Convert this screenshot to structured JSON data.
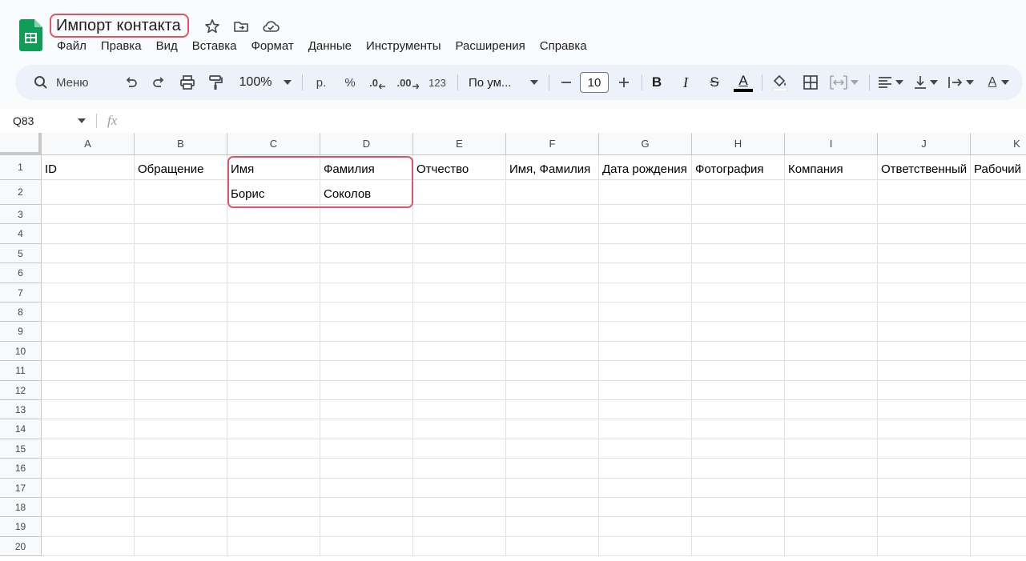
{
  "document": {
    "title": "Импорт контакта"
  },
  "menu": [
    "Файл",
    "Правка",
    "Вид",
    "Вставка",
    "Формат",
    "Данные",
    "Инструменты",
    "Расширения",
    "Справка"
  ],
  "toolbar": {
    "search_label": "Меню",
    "zoom": "100%",
    "currency": "р.",
    "percent": "%",
    "decrease_decimals": ".0",
    "increase_decimals": ".00",
    "number_format": "123",
    "font": "По ум...",
    "font_size": "10",
    "bold": "B",
    "italic": "I",
    "strikethrough": "S",
    "text_color": "A",
    "text_rotation": "A"
  },
  "formula_bar": {
    "cell_ref": "Q83",
    "fx": "fx"
  },
  "sheet": {
    "columns": [
      "A",
      "B",
      "C",
      "D",
      "E",
      "F",
      "G",
      "H",
      "I",
      "J",
      "K"
    ],
    "rows": [
      "1",
      "2",
      "3",
      "4",
      "5",
      "6",
      "7",
      "8",
      "9",
      "10",
      "11",
      "12",
      "13",
      "14",
      "15",
      "16",
      "17",
      "18",
      "19",
      "20"
    ],
    "row1": [
      "ID",
      "Обращение",
      "Имя",
      "Фамилия",
      "Отчество",
      "Имя, Фамилия",
      "Дата рождения",
      "Фотография",
      "Компания",
      "Ответственный",
      "Рабочий"
    ],
    "row2": [
      "",
      "",
      "Борис",
      "Соколов",
      "",
      "",
      "",
      "",
      "",
      "",
      ""
    ]
  },
  "colors": {
    "highlight": "#e05564",
    "sheets_green": "#0f9d58",
    "toolbar_bg": "#edf2fa"
  }
}
